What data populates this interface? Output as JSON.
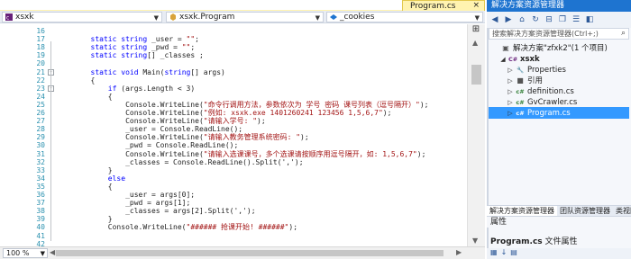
{
  "editor": {
    "doc_tab": "Program.cs",
    "doc_tab_close": "×",
    "nav": {
      "project": "xsxk",
      "type": "xsxk.Program",
      "member": "_cookies"
    },
    "zoom": "100 %",
    "line_numbers": [
      "16",
      "17",
      "18",
      "19",
      "20",
      "21",
      "22",
      "23",
      "24",
      "25",
      "26",
      "27",
      "28",
      "29",
      "30",
      "31",
      "32",
      "33",
      "34",
      "35",
      "36",
      "37",
      "38",
      "39",
      "40",
      "41",
      "42"
    ],
    "lines": [
      [],
      [
        {
          "t": "        "
        },
        {
          "t": "static",
          "k": "kw"
        },
        {
          "t": " "
        },
        {
          "t": "string",
          "k": "kw"
        },
        {
          "t": " _user = "
        },
        {
          "t": "\"\"",
          "k": "st"
        },
        {
          "t": ";"
        }
      ],
      [
        {
          "t": "        "
        },
        {
          "t": "static",
          "k": "kw"
        },
        {
          "t": " "
        },
        {
          "t": "string",
          "k": "kw"
        },
        {
          "t": " _pwd = "
        },
        {
          "t": "\"\"",
          "k": "st"
        },
        {
          "t": ";"
        }
      ],
      [
        {
          "t": "        "
        },
        {
          "t": "static",
          "k": "kw"
        },
        {
          "t": " "
        },
        {
          "t": "string",
          "k": "kw"
        },
        {
          "t": "[] _classes ;"
        }
      ],
      [],
      [
        {
          "t": "        "
        },
        {
          "t": "static",
          "k": "kw"
        },
        {
          "t": " "
        },
        {
          "t": "void",
          "k": "kw"
        },
        {
          "t": " Main("
        },
        {
          "t": "string",
          "k": "kw"
        },
        {
          "t": "[] args)"
        }
      ],
      [
        {
          "t": "        {"
        }
      ],
      [
        {
          "t": "            "
        },
        {
          "t": "if",
          "k": "kw"
        },
        {
          "t": " (args.Length < 3)"
        }
      ],
      [
        {
          "t": "            {"
        }
      ],
      [
        {
          "t": "                Console.WriteLine("
        },
        {
          "t": "\"命令行调用方法，参数依次为 学号 密码 课号列表（逗号隔开）\"",
          "k": "st"
        },
        {
          "t": ");"
        }
      ],
      [
        {
          "t": "                Console.WriteLine("
        },
        {
          "t": "\"例如: xsxk.exe 1401260241 123456 1,5,6,7\"",
          "k": "st"
        },
        {
          "t": ");"
        }
      ],
      [
        {
          "t": "                Console.WriteLine("
        },
        {
          "t": "\"请输入学号: \"",
          "k": "st"
        },
        {
          "t": ");"
        }
      ],
      [
        {
          "t": "                _user = Console.ReadLine();"
        }
      ],
      [
        {
          "t": "                Console.WriteLine("
        },
        {
          "t": "\"请输入教务管理系统密码: \"",
          "k": "st"
        },
        {
          "t": ");"
        }
      ],
      [
        {
          "t": "                _pwd = Console.ReadLine();"
        }
      ],
      [
        {
          "t": "                Console.WriteLine("
        },
        {
          "t": "\"请输入选课课号，多个选课请按顺序用逗号隔开，如: 1,5,6,7\"",
          "k": "st"
        },
        {
          "t": ");"
        }
      ],
      [
        {
          "t": "                _classes = Console.ReadLine().Split(',');"
        }
      ],
      [
        {
          "t": "            }"
        }
      ],
      [
        {
          "t": "            "
        },
        {
          "t": "else",
          "k": "kw"
        }
      ],
      [
        {
          "t": "            {"
        }
      ],
      [
        {
          "t": "                _user = args[0];"
        }
      ],
      [
        {
          "t": "                _pwd = args[1];"
        }
      ],
      [
        {
          "t": "                _classes = args[2].Split(',');"
        }
      ],
      [
        {
          "t": "            }"
        }
      ],
      [
        {
          "t": "            Console.WriteLine("
        },
        {
          "t": "\"###### 抢课开始! ######\"",
          "k": "st"
        },
        {
          "t": ");"
        }
      ]
    ]
  },
  "solution": {
    "title": "解决方案资源管理器",
    "search_placeholder": "搜索解决方案资源管理器(Ctrl+;)",
    "tree": [
      {
        "label": "解决方案\"zfxk2\"(1 个项目)",
        "icon": "solution-icon",
        "glyph": "▣"
      },
      {
        "label": "xsxk",
        "icon": "project-icon",
        "glyph": "C#",
        "bold": true
      },
      {
        "label": "Properties",
        "icon": "wrench-icon",
        "glyph": "🔧"
      },
      {
        "label": "引用",
        "icon": "references-icon",
        "glyph": "■"
      },
      {
        "label": "definition.cs",
        "icon": "csharp-file-icon",
        "glyph": "c#"
      },
      {
        "label": "GvCrawler.cs",
        "icon": "csharp-file-icon",
        "glyph": "c#"
      },
      {
        "label": "Program.cs",
        "icon": "csharp-file-icon",
        "glyph": "c#",
        "selected": true
      }
    ],
    "tabs": [
      "解决方案资源管理器",
      "团队资源管理器",
      "类视图"
    ]
  },
  "properties": {
    "title": "属性",
    "object_name": "Program.cs",
    "object_kind": "文件属性"
  },
  "colors": {
    "accent": "#1e74d0",
    "selection": "#3399ff",
    "tab_active": "#fff3b0",
    "keyword": "#0000ff",
    "string": "#a31515",
    "line_number": "#2b91af"
  }
}
